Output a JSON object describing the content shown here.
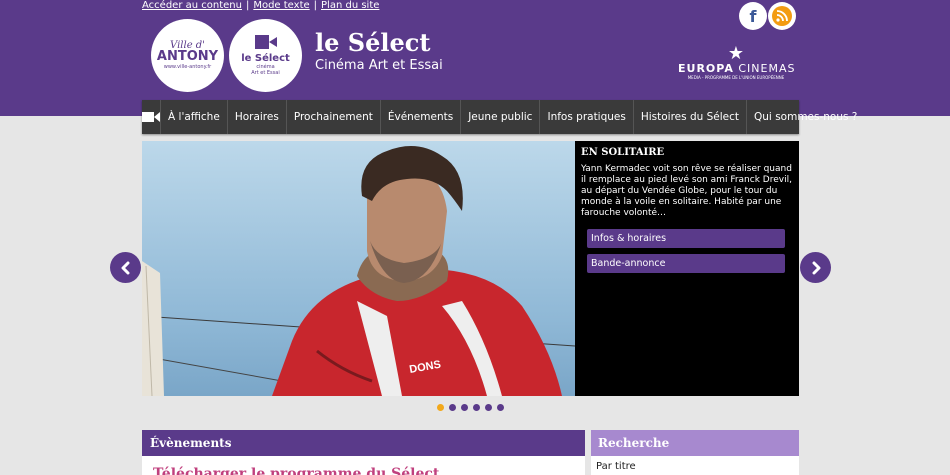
{
  "skip_links": {
    "content": "Accéder au contenu",
    "text_mode": "Mode texte",
    "sitemap": "Plan du site",
    "separator": "|"
  },
  "social": {
    "facebook_icon": "facebook-icon",
    "facebook_glyph": "f",
    "rss_icon": "rss-icon"
  },
  "logos": {
    "antony_ville": "Ville d'",
    "antony_name": "ANTONY",
    "antony_url": "www.ville-antony.fr",
    "select_name": "le Sélect",
    "select_sub1": "cinéma",
    "select_sub2": "Art et Essai"
  },
  "site": {
    "title": "le Sélect",
    "subtitle": "Cinéma Art et Essai"
  },
  "europa": {
    "star": "★",
    "name_bold": "EUROPA",
    "name_rest": "CINEMAS",
    "sub": "MEDIA - PROGRAMME DE L'UNION EUROPÉENNE"
  },
  "nav": {
    "home_icon": "camera-icon",
    "items": [
      "À l'affiche",
      "Horaires",
      "Prochainement",
      "Événements",
      "Jeune public",
      "Infos pratiques",
      "Histoires du Sélect",
      "Qui sommes-nous ?"
    ]
  },
  "slide": {
    "title": "EN SOLITAIRE",
    "text": "Yann Kermadec voit son rêve se réaliser quand il remplace au pied levé son ami Franck Drevil, au départ du Vendée Globe, pour le tour du monde à la voile en solitaire. Habité par une farouche volonté…",
    "btn_info": "Infos & horaires",
    "btn_trailer": "Bande-annonce",
    "jacket_logo": "DONS"
  },
  "carousel": {
    "prev_icon": "chevron-left-icon",
    "next_icon": "chevron-right-icon",
    "dot_count": 6,
    "active_index": 0
  },
  "events": {
    "heading": "Évènements",
    "link": "Télécharger le programme du Sélect"
  },
  "search": {
    "heading": "Recherche",
    "label": "Par titre"
  },
  "colors": {
    "brand": "#5a3a8a",
    "accent": "#a789cf",
    "dot_active": "#f2a81a",
    "link": "#c0407e"
  }
}
